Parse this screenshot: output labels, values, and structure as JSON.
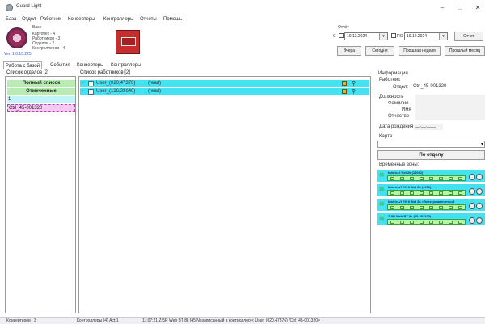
{
  "window": {
    "title": "Guard Light",
    "controls": [
      "–",
      "□",
      "✕"
    ]
  },
  "menu": [
    "База",
    "Отдел",
    "Работник",
    "Конвертеры",
    "Контроллеры",
    "Отчеты",
    "Помощь"
  ],
  "base_info": {
    "title": "Base",
    "cards": "Карточек - 4",
    "workers": "Работников - 3",
    "departments": "Отделов - 2",
    "controllers": "Контроллеров - 4",
    "version": "Ver. 1.0.10.225"
  },
  "report": {
    "label": "Отчёт",
    "from_label": "С",
    "from_date": "10.12.2024",
    "to_label": "ПО",
    "to_date": "10.12.2024",
    "report_button": "Отчет",
    "quick_buttons": [
      "Вчера",
      "Сегодня",
      "Прошлая неделя",
      "Прошлый месяц"
    ]
  },
  "tabs": [
    "Работа с базой",
    "События",
    "Конвертеры",
    "Контроллеры"
  ],
  "departments": {
    "header": "Список отделов [2]",
    "items": [
      "Полный список",
      "Отмеченные",
      "1",
      "Ctrl_45-001320"
    ],
    "colors": {
      "full": "#b8ecb3",
      "marked": "#b8ecb3",
      "dept1": "#c4f2f9",
      "dept2": "#f6c9f4"
    }
  },
  "workers": {
    "header": "Список работников [2]",
    "rows": [
      {
        "name": "User_(020,47376)",
        "mode": "(read)"
      },
      {
        "name": "User_(136,39640)",
        "mode": "(read)"
      }
    ]
  },
  "info": {
    "header": "Информация",
    "worker_label": "Работник",
    "dept_label": "Отдел:",
    "dept_value": "Ctrl_45-001320",
    "position_label": "Должность",
    "surname_label": "Фамилия",
    "name_label": "Имя",
    "patronymic_label": "Отчество",
    "birth_label": "Дата рождения",
    "birth_value": "__.__.____",
    "card_label": "Карта",
    "by_dept_button": "По отделу",
    "zones_label": "Временные зоны:",
    "zones": [
      "Matrix-II Net 2k (18092)",
      "Matrix-VI EH K Net 8k (1970)",
      "Matrix-VI EH K Net 8k <Электромагнитный",
      "Z-5R Web BT 8k (45-001320)"
    ]
  },
  "status": {
    "converters": "Конвертеров : 3",
    "controllers": "Контроллеры (4) Act:1",
    "message": "11:07:21 Z-5R Web BT 8k [45]Neзаписанный в контроллер < User_(020,47376) /Ctrl_45-001320>"
  }
}
